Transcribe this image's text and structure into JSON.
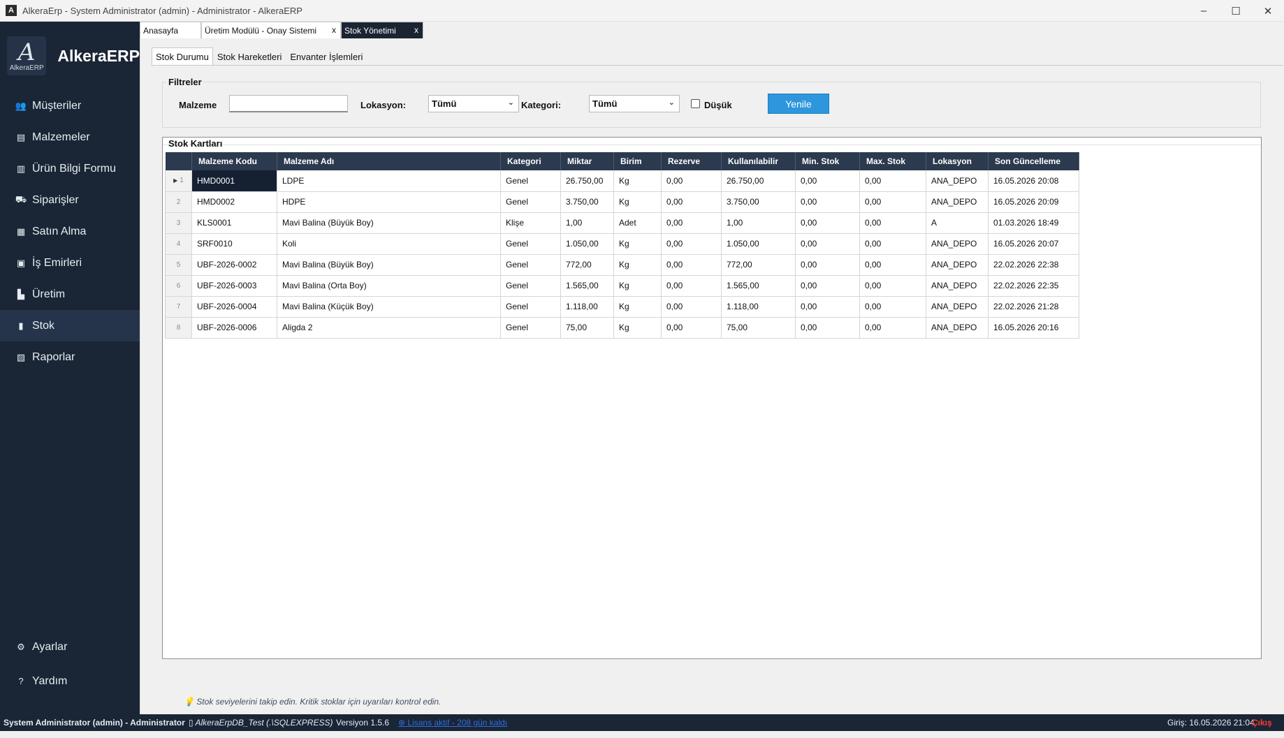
{
  "window": {
    "title": "AlkeraErp - System Administrator (admin) - Administrator - AlkeraERP",
    "app_icon": "A",
    "controls": {
      "minimize": "–",
      "maximize": "☐",
      "close": "✕"
    }
  },
  "sidebar": {
    "brand": "AlkeraERP",
    "logo_text": "AlkeraERP",
    "logo_glyph": "A",
    "items": [
      {
        "label": "Müşteriler",
        "icon": "users-icon",
        "glyph": "👥"
      },
      {
        "label": "Malzemeler",
        "icon": "box-icon",
        "glyph": "▤"
      },
      {
        "label": "Ürün Bilgi Formu",
        "icon": "form-icon",
        "glyph": "▥"
      },
      {
        "label": "Siparişler",
        "icon": "orders-icon",
        "glyph": "⛟"
      },
      {
        "label": "Satın Alma",
        "icon": "cart-icon",
        "glyph": "▦"
      },
      {
        "label": "İş Emirleri",
        "icon": "clipboard-icon",
        "glyph": "▣"
      },
      {
        "label": "Üretim",
        "icon": "factory-icon",
        "glyph": "▙"
      },
      {
        "label": "Stok",
        "icon": "chart-icon",
        "glyph": "▮"
      },
      {
        "label": "Raporlar",
        "icon": "report-icon",
        "glyph": "▧"
      }
    ],
    "active_index": 7,
    "bottom": [
      {
        "label": "Ayarlar",
        "icon": "gear-icon",
        "glyph": "⚙"
      },
      {
        "label": "Yardım",
        "icon": "help-icon",
        "glyph": "?"
      }
    ]
  },
  "doc_tabs": [
    {
      "label": "Anasayfa",
      "close": ""
    },
    {
      "label": "Üretim Modülü - Onay Sistemi",
      "close": "x"
    },
    {
      "label": "Stok Yönetimi",
      "close": "x"
    }
  ],
  "sub_tabs": [
    "Stok Durumu",
    "Stok Hareketleri",
    "Envanter İşlemleri"
  ],
  "filters": {
    "legend": "Filtreler",
    "material_label": "Malzeme",
    "material_value": "",
    "location_label": "Lokasyon:",
    "location_value": "Tümü",
    "category_label": "Kategori:",
    "category_value": "Tümü",
    "low_label": "Düşük",
    "low_checked": false,
    "refresh_label": "Yenile"
  },
  "stock_cards": {
    "legend": "Stok Kartları",
    "columns": [
      "Malzeme Kodu",
      "Malzeme Adı",
      "Kategori",
      "Miktar",
      "Birim",
      "Rezerve",
      "Kullanılabilir",
      "Min. Stok",
      "Max. Stok",
      "Lokasyon",
      "Son Güncelleme"
    ],
    "rows": [
      {
        "no": "1",
        "cells": [
          "HMD0001",
          "LDPE",
          "Genel",
          "26.750,00",
          "Kg",
          "0,00",
          "26.750,00",
          "0,00",
          "0,00",
          "ANA_DEPO",
          "16.05.2026 20:08"
        ]
      },
      {
        "no": "2",
        "cells": [
          "HMD0002",
          "HDPE",
          "Genel",
          "3.750,00",
          "Kg",
          "0,00",
          "3.750,00",
          "0,00",
          "0,00",
          "ANA_DEPO",
          "16.05.2026 20:09"
        ]
      },
      {
        "no": "3",
        "cells": [
          "KLS0001",
          "Mavi Balina (Büyük Boy)",
          "Klişe",
          "1,00",
          "Adet",
          "0,00",
          "1,00",
          "0,00",
          "0,00",
          "A",
          "01.03.2026 18:49"
        ]
      },
      {
        "no": "4",
        "cells": [
          "SRF0010",
          "Koli",
          "Genel",
          "1.050,00",
          "Kg",
          "0,00",
          "1.050,00",
          "0,00",
          "0,00",
          "ANA_DEPO",
          "16.05.2026 20:07"
        ]
      },
      {
        "no": "5",
        "cells": [
          "UBF-2026-0002",
          "Mavi Balina (Büyük Boy)",
          "Genel",
          "772,00",
          "Kg",
          "0,00",
          "772,00",
          "0,00",
          "0,00",
          "ANA_DEPO",
          "22.02.2026 22:38"
        ]
      },
      {
        "no": "6",
        "cells": [
          "UBF-2026-0003",
          "Mavi Balina (Orta Boy)",
          "Genel",
          "1.565,00",
          "Kg",
          "0,00",
          "1.565,00",
          "0,00",
          "0,00",
          "ANA_DEPO",
          "22.02.2026 22:35"
        ]
      },
      {
        "no": "7",
        "cells": [
          "UBF-2026-0004",
          "Mavi Balina (Küçük Boy)",
          "Genel",
          "1.118,00",
          "Kg",
          "0,00",
          "1.118,00",
          "0,00",
          "0,00",
          "ANA_DEPO",
          "22.02.2026 21:28"
        ]
      },
      {
        "no": "8",
        "cells": [
          "UBF-2026-0006",
          "Aligda 2",
          "Genel",
          "75,00",
          "Kg",
          "0,00",
          "75,00",
          "0,00",
          "0,00",
          "ANA_DEPO",
          "16.05.2026 20:16"
        ]
      }
    ],
    "selected_row": 0
  },
  "hint": "💡 Stok seviyelerini takip edin. Kritik stoklar için uyarıları kontrol edin.",
  "statusbar": {
    "user": "System Administrator (admin) - Administrator",
    "db": "▯ AlkeraErpDB_Test (.\\SQLEXPRESS)",
    "version": "Versiyon 1.5.6",
    "link": "⊕ Lisans aktif - 208 gün kaldı",
    "login": "Giriş: 16.05.2026 21:04",
    "exit": "Çıkış"
  },
  "colors": {
    "sidebar_bg": "#1a2535",
    "header_bg": "#2b3a4e",
    "accent": "#2d96dc",
    "exit": "#ff3b30"
  }
}
